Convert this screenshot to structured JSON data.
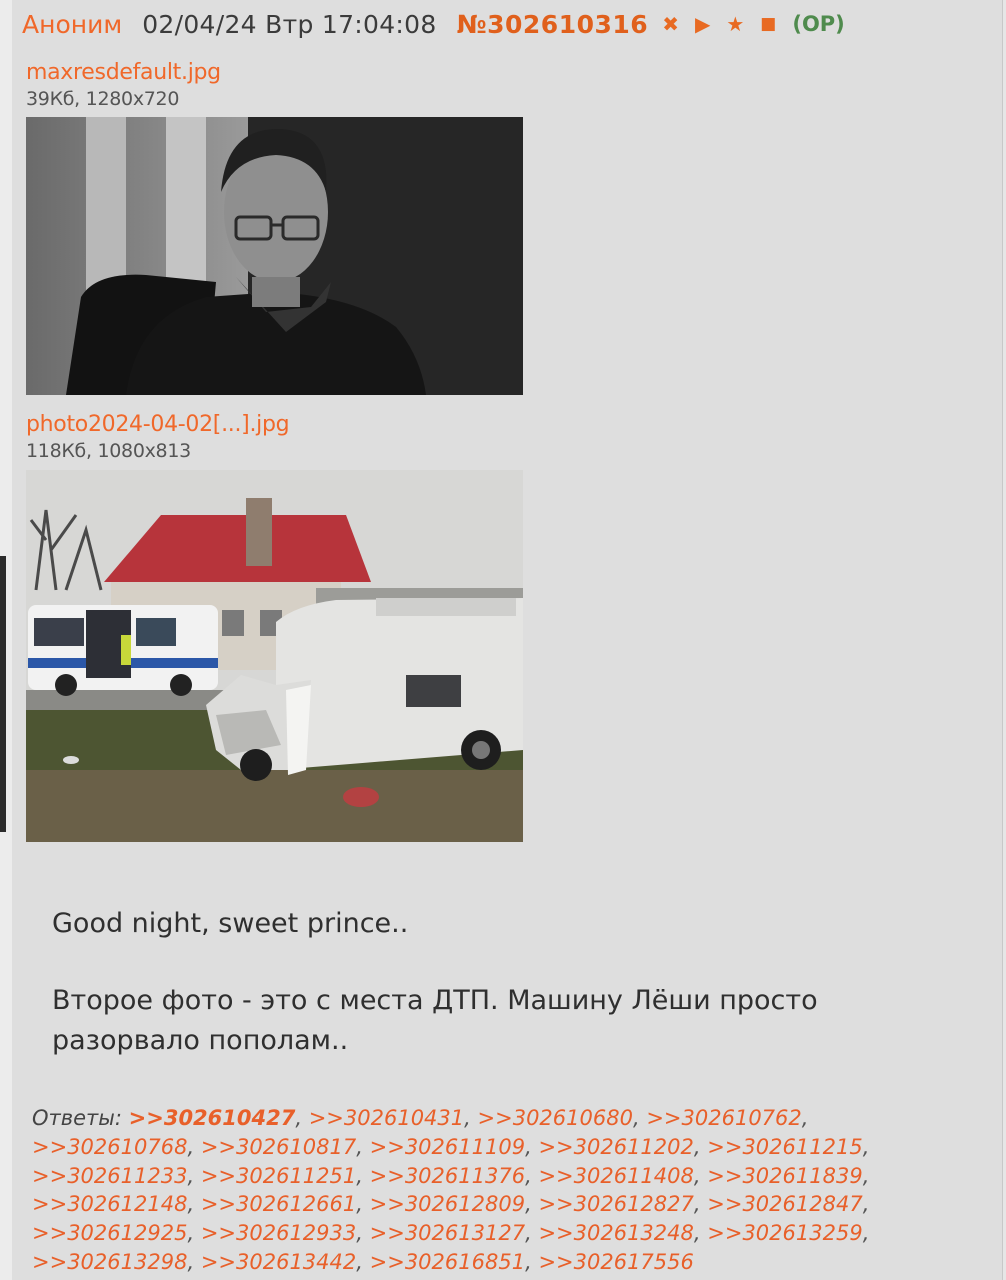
{
  "post": {
    "author": "Аноним",
    "datetime": "02/04/24 Втр 17:04:08",
    "number": "№302610316",
    "op_tag": "(OP)",
    "icons": [
      "hide-icon",
      "play-icon",
      "favorite-star-icon",
      "report-square-icon"
    ],
    "accent_color": "#f0682a",
    "op_color": "#4f8b4d"
  },
  "files": [
    {
      "name": "maxresdefault.jpg",
      "meta": "39Кб, 1280x720"
    },
    {
      "name": "photo2024-04-02[...].jpg",
      "meta": "118Кб, 1080x813"
    }
  ],
  "message": {
    "line1": "Good night, sweet prince..",
    "line2": "Второе фото - это с места ДТП. Машину Лёши просто разорвало пополам.."
  },
  "replies": {
    "label": "Ответы:",
    "refs": [
      ">>302610427",
      ">>302610431",
      ">>302610680",
      ">>302610762",
      ">>302610768",
      ">>302610817",
      ">>302611109",
      ">>302611202",
      ">>302611215",
      ">>302611233",
      ">>302611251",
      ">>302611376",
      ">>302611408",
      ">>302611839",
      ">>302612148",
      ">>302612661",
      ">>302612809",
      ">>302612827",
      ">>302612847",
      ">>302612925",
      ">>302612933",
      ">>302613127",
      ">>302613248",
      ">>302613259",
      ">>302613298",
      ">>302613442",
      ">>302616851",
      ">>302617556"
    ]
  }
}
